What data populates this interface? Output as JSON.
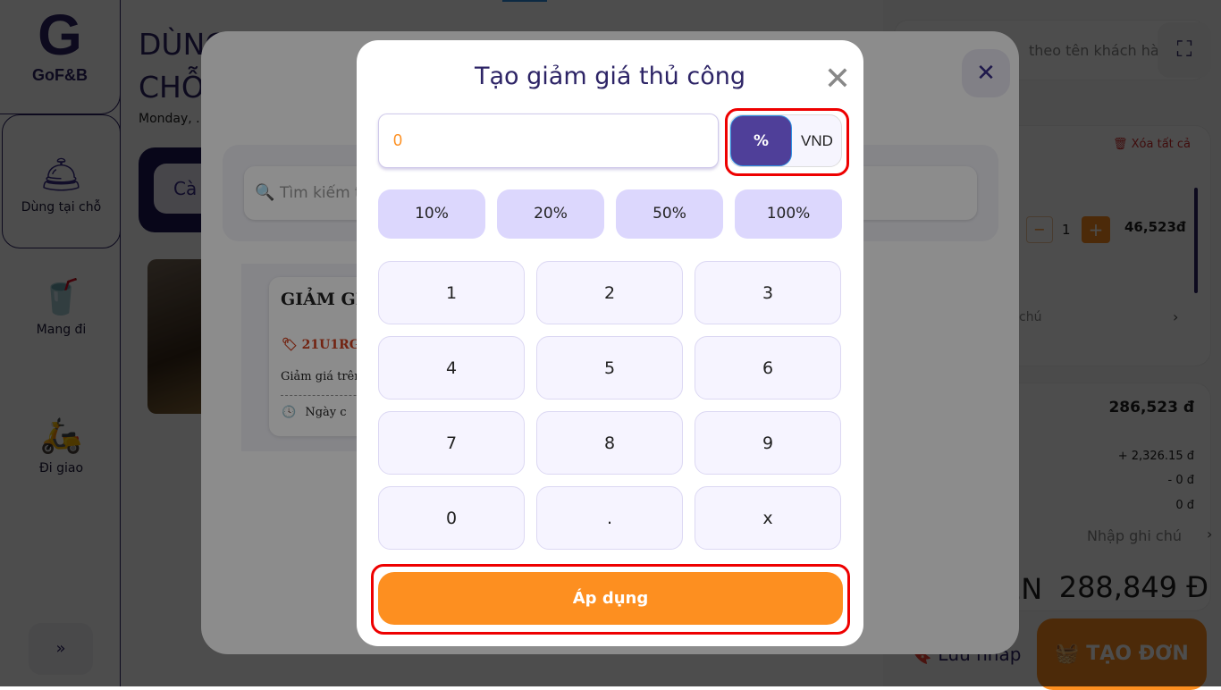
{
  "sidebar": {
    "logo_text": "GoF&B",
    "items": [
      {
        "label": "Dùng tại chỗ",
        "icon": "cloche-icon"
      },
      {
        "label": "Mang đi",
        "icon": "takeaway-icon"
      },
      {
        "label": "Đi giao",
        "icon": "delivery-scooter-icon"
      }
    ],
    "expand": "»"
  },
  "main": {
    "title": "DÙNG TẠI CHỖ",
    "date": "Monday, .",
    "category": "Cà",
    "search_placeholder": "Tìm kiếm t"
  },
  "voucher": {
    "title": "GIẢM GI",
    "code": "21U1RG",
    "desc": "Giảm giá trên",
    "date": "Ngày c"
  },
  "right": {
    "search_placeholder": "theo tên khách hàng",
    "clear_all": "Xóa tất cả",
    "qty": "1",
    "item_price": "46,523đ",
    "note_partial": "chú",
    "subtotal": "286,523 đ",
    "tax": "+ 2,326.15 đ",
    "discount": "- 0 đ",
    "other": "0 đ",
    "note": "Nhập ghi chú",
    "total_label": "ỀN",
    "total": "288,849 Đ",
    "save_draft": "Lưu nháp",
    "create_order": "TẠO ĐƠN"
  },
  "dialog": {
    "title": "Tạo giảm giá thủ công",
    "value": "0",
    "unit_options": [
      "%",
      "VND"
    ],
    "selected_unit": "%",
    "presets": [
      "10%",
      "20%",
      "50%",
      "100%"
    ],
    "keys": [
      "1",
      "2",
      "3",
      "4",
      "5",
      "6",
      "7",
      "8",
      "9",
      "0",
      ".",
      "x"
    ],
    "apply": "Áp dụng"
  },
  "colors": {
    "brand": "#2d2466",
    "accent": "#fd8f20",
    "active_toggle": "#4f3f99",
    "preset_bg": "#dcd7fd",
    "highlight": "#e00000"
  }
}
